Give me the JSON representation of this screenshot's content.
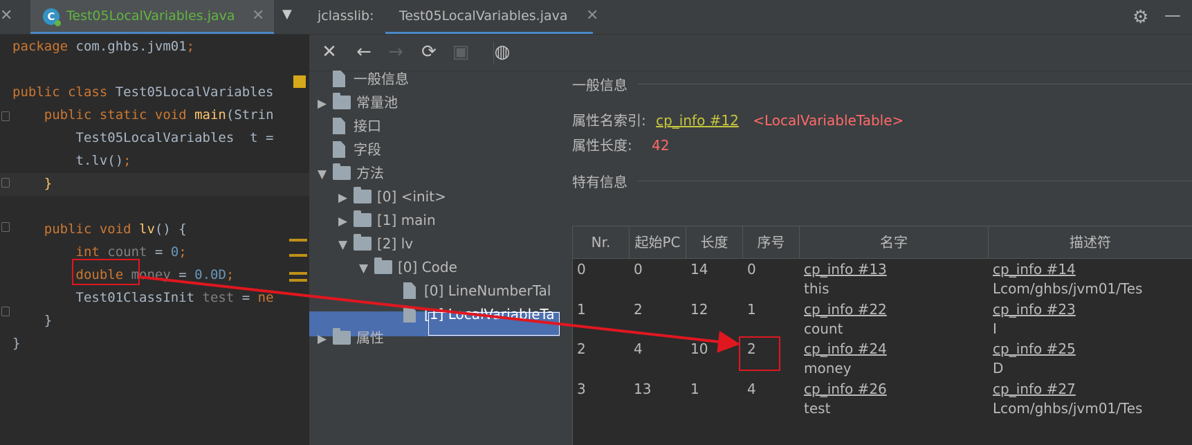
{
  "editor": {
    "tab_title": "Test05LocalVariables.java",
    "code_lines": [
      [
        [
          "kw",
          "package "
        ],
        [
          "pl",
          "com.ghbs.jvm01"
        ],
        [
          "kw",
          ";"
        ]
      ],
      [],
      [
        [
          "kw",
          "public class "
        ],
        [
          "pl",
          "Test05LocalVariables"
        ]
      ],
      [
        [
          "kw",
          "    public static void "
        ],
        [
          "fn",
          "main"
        ],
        [
          "pl",
          "(Strin"
        ]
      ],
      [
        [
          "pl",
          "        Test05LocalVariables  t ="
        ]
      ],
      [
        [
          "pl",
          "        t.lv()"
        ],
        [
          "kw",
          ";"
        ]
      ],
      [
        [
          "fn",
          "    }"
        ]
      ],
      [],
      [
        [
          "kw",
          "    public void "
        ],
        [
          "fn",
          "lv"
        ],
        [
          "pl",
          "() {"
        ]
      ],
      [
        [
          "kw",
          "        int "
        ],
        [
          "unused",
          "count"
        ],
        [
          "pl",
          " = "
        ],
        [
          "num",
          "0"
        ],
        [
          "kw",
          ";"
        ]
      ],
      [
        [
          "kw",
          "        double "
        ],
        [
          "unused",
          "money"
        ],
        [
          "pl",
          " = "
        ],
        [
          "num",
          "0.0D"
        ],
        [
          "kw",
          ";"
        ]
      ],
      [
        [
          "pl",
          "        Test01ClassInit "
        ],
        [
          "unused",
          "test"
        ],
        [
          "pl",
          " = "
        ],
        [
          "kw",
          "ne"
        ]
      ],
      [
        [
          "pl",
          "    }"
        ]
      ],
      [
        [
          "pl",
          "}"
        ]
      ]
    ]
  },
  "jclasslib": {
    "label": "jclasslib:",
    "tab_title": "Test05LocalVariables.java",
    "tree": [
      {
        "label": "一般信息",
        "icon": "file",
        "arrow": "",
        "depth": 0
      },
      {
        "label": "常量池",
        "icon": "folder",
        "arrow": "▶",
        "depth": 0
      },
      {
        "label": "接口",
        "icon": "file",
        "arrow": "",
        "depth": 0
      },
      {
        "label": "字段",
        "icon": "file",
        "arrow": "",
        "depth": 0
      },
      {
        "label": "方法",
        "icon": "folder",
        "arrow": "▼",
        "depth": 0
      },
      {
        "label": "[0] <init>",
        "icon": "folder",
        "arrow": "▶",
        "depth": 1
      },
      {
        "label": "[1] main",
        "icon": "folder",
        "arrow": "▶",
        "depth": 1
      },
      {
        "label": "[2] lv",
        "icon": "folder",
        "arrow": "▼",
        "depth": 1
      },
      {
        "label": "[0] Code",
        "icon": "folder",
        "arrow": "▼",
        "depth": 2
      },
      {
        "label": "[0] LineNumberTal",
        "icon": "file",
        "arrow": "",
        "depth": 3
      },
      {
        "label": "[1] LocalVariableTa",
        "icon": "file",
        "arrow": "",
        "depth": 3
      },
      {
        "label": "属性",
        "icon": "folder",
        "arrow": "▶",
        "depth": 0
      }
    ],
    "general_title": "一般信息",
    "attr_name_label": "属性名索引:",
    "attr_name_link": "cp_info #12",
    "attr_name_value": "<LocalVariableTable>",
    "attr_len_label": "属性长度:",
    "attr_len_value": "42",
    "specific_title": "特有信息",
    "columns": [
      "Nr.",
      "起始PC",
      "长度",
      "序号",
      "名字",
      "描述符"
    ],
    "rows": [
      {
        "nr": "0",
        "pc": "0",
        "len": "14",
        "idx": "0",
        "name_link": "cp_info #13",
        "name": "this",
        "desc_link": "cp_info #14",
        "desc": "Lcom/ghbs/jvm01/Tes"
      },
      {
        "nr": "1",
        "pc": "2",
        "len": "12",
        "idx": "1",
        "name_link": "cp_info #22",
        "name": "count",
        "desc_link": "cp_info #23",
        "desc": "I"
      },
      {
        "nr": "2",
        "pc": "4",
        "len": "10",
        "idx": "2",
        "name_link": "cp_info #24",
        "name": "money",
        "desc_link": "cp_info #25",
        "desc": "D"
      },
      {
        "nr": "3",
        "pc": "13",
        "len": "1",
        "idx": "4",
        "name_link": "cp_info #26",
        "name": "test",
        "desc_link": "cp_info #27",
        "desc": "Lcom/ghbs/jvm01/Tes"
      }
    ]
  },
  "colors": {
    "accent": "#4a88c7",
    "selection": "#4b6eaf",
    "annotation": "#e0171f",
    "link": "#c7c73e",
    "value_red": "#ff6b68"
  }
}
